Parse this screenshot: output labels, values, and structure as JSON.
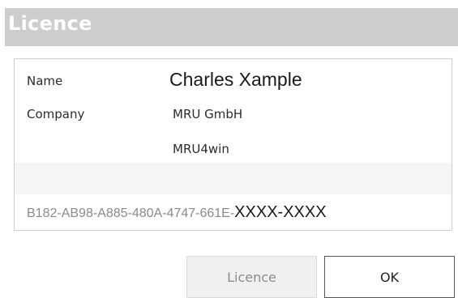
{
  "window": {
    "title": "Licence"
  },
  "licence_info": {
    "name_label": "Name",
    "name_value": "Charles Xample",
    "company_label": "Company",
    "company_value": "MRU GmbH",
    "product_value": "MRU4win",
    "key_prefix": "B182-AB98-A885-480A-4747-661E-",
    "key_suffix": "XXXX-XXXX"
  },
  "buttons": {
    "licence_label": "Licence",
    "ok_label": "OK"
  }
}
